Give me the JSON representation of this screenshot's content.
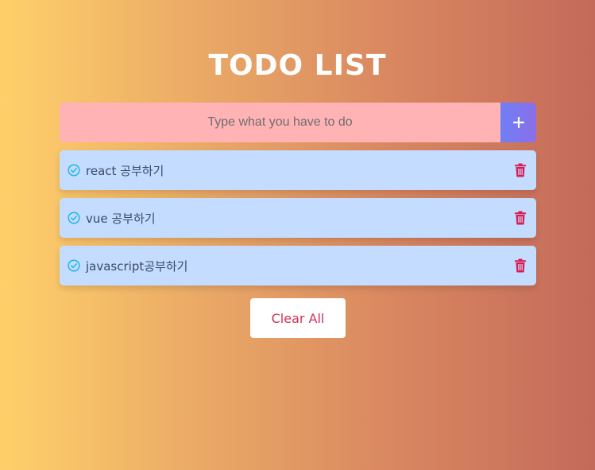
{
  "header": {
    "title": "TODO LIST"
  },
  "input": {
    "placeholder": "Type what you have to do",
    "value": ""
  },
  "add_button": {
    "icon": "plus-icon",
    "label": "+"
  },
  "todos": [
    {
      "text": "react 공부하기",
      "check_icon": "check-circle-icon",
      "delete_icon": "trash-icon"
    },
    {
      "text": "vue 공부하기",
      "check_icon": "check-circle-icon",
      "delete_icon": "trash-icon"
    },
    {
      "text": "javascript공부하기",
      "check_icon": "check-circle-icon",
      "delete_icon": "trash-icon"
    }
  ],
  "footer": {
    "clear_label": "Clear All"
  },
  "colors": {
    "input_bg": "#ffb3b5",
    "item_bg": "#c3dcff",
    "check": "#1fb5e6",
    "trash": "#d81b50",
    "clear_text": "#d1305a"
  }
}
